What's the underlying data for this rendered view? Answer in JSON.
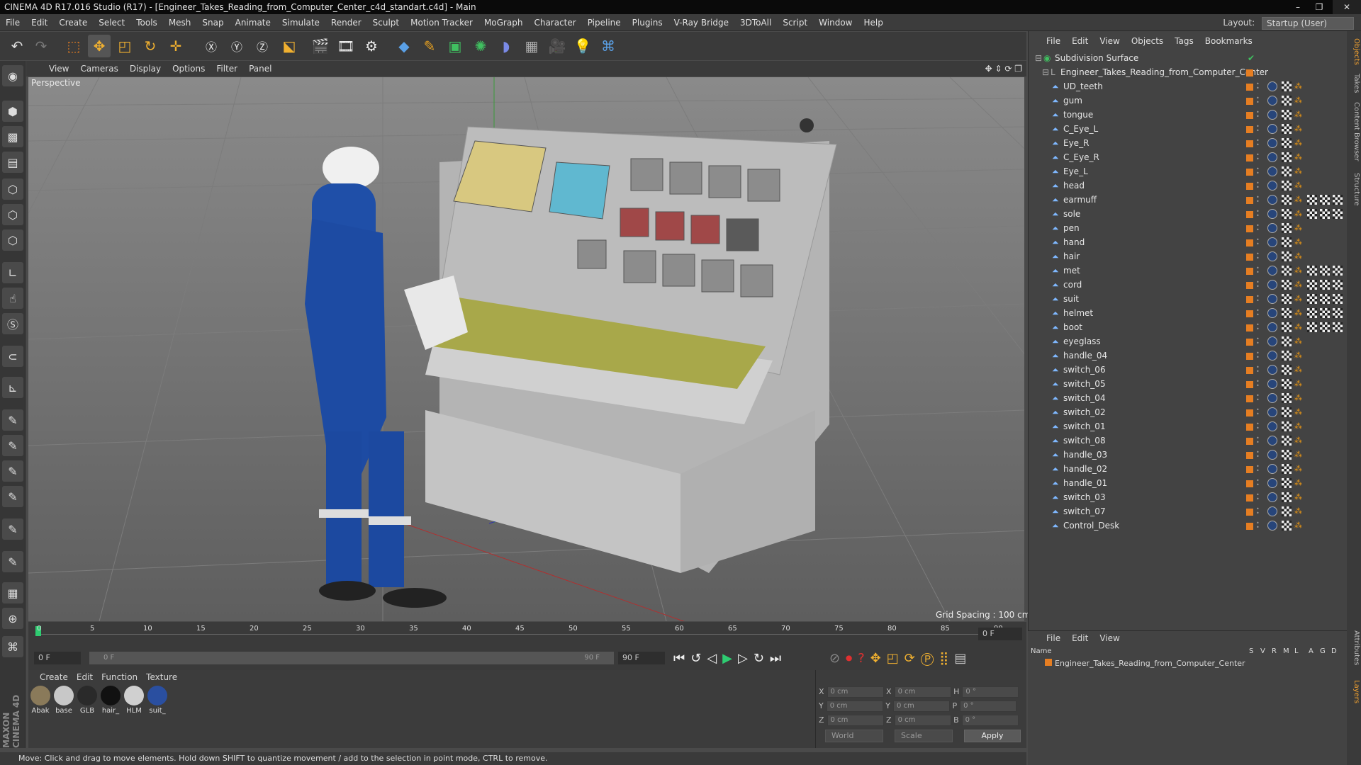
{
  "window": {
    "title": "CINEMA 4D R17.016 Studio (R17) - [Engineer_Takes_Reading_from_Computer_Center_c4d_standart.c4d] - Main"
  },
  "menubar": {
    "items": [
      "File",
      "Edit",
      "Create",
      "Select",
      "Tools",
      "Mesh",
      "Snap",
      "Animate",
      "Simulate",
      "Render",
      "Sculpt",
      "Motion Tracker",
      "MoGraph",
      "Character",
      "Pipeline",
      "Plugins",
      "V-Ray Bridge",
      "3DToAll",
      "Script",
      "Window",
      "Help"
    ],
    "layout_label": "Layout:",
    "layout_value": "Startup (User)"
  },
  "viewport": {
    "menu": [
      "View",
      "Cameras",
      "Display",
      "Options",
      "Filter",
      "Panel"
    ],
    "label": "Perspective",
    "grid_spacing": "Grid Spacing : 100 cm"
  },
  "timeline": {
    "ticks": [
      "0",
      "5",
      "10",
      "15",
      "20",
      "25",
      "30",
      "35",
      "40",
      "45",
      "50",
      "55",
      "60",
      "65",
      "70",
      "75",
      "80",
      "85",
      "90"
    ],
    "current_frame": "0 F",
    "start_frame": "0 F",
    "range_start": "0 F",
    "range_end": "90 F",
    "end_frame": "90 F"
  },
  "materials": {
    "menu": [
      "Create",
      "Edit",
      "Function",
      "Texture"
    ],
    "items": [
      {
        "label": "Abak",
        "color": "#8a7a5a"
      },
      {
        "label": "base",
        "color": "#c8c8c8"
      },
      {
        "label": "GLB",
        "color": "#2a2a2a"
      },
      {
        "label": "hair_",
        "color": "#111111"
      },
      {
        "label": "HLM",
        "color": "#d0d0d0"
      },
      {
        "label": "suit_",
        "color": "#2a4fa0"
      }
    ]
  },
  "coords": {
    "rows": [
      {
        "a": "X",
        "av": "0 cm",
        "b": "X",
        "bv": "0 cm",
        "c": "H",
        "cv": "0 °"
      },
      {
        "a": "Y",
        "av": "0 cm",
        "b": "Y",
        "bv": "0 cm",
        "c": "P",
        "cv": "0 °"
      },
      {
        "a": "Z",
        "av": "0 cm",
        "b": "Z",
        "bv": "0 cm",
        "c": "B",
        "cv": "0 °"
      }
    ],
    "world": "World",
    "scale": "Scale",
    "apply": "Apply"
  },
  "status": {
    "text": "Move: Click and drag to move elements. Hold down SHIFT to quantize movement / add to the selection in point mode, CTRL to remove."
  },
  "objects": {
    "menu": [
      "File",
      "Edit",
      "View",
      "Objects",
      "Tags",
      "Bookmarks"
    ],
    "root": "Subdivision Surface",
    "group": "Engineer_Takes_Reading_from_Computer_Center",
    "items": [
      "UD_teeth",
      "gum",
      "tongue",
      "C_Eye_L",
      "Eye_R",
      "C_Eye_R",
      "Eye_L",
      "head",
      "earmuff",
      "sole",
      "pen",
      "hand",
      "hair",
      "met",
      "cord",
      "suit",
      "helmet",
      "boot",
      "eyeglass",
      "handle_04",
      "switch_06",
      "switch_05",
      "switch_04",
      "switch_02",
      "switch_01",
      "switch_08",
      "handle_03",
      "handle_02",
      "handle_01",
      "switch_03",
      "switch_07",
      "Control_Desk"
    ]
  },
  "attributes": {
    "menu": [
      "File",
      "Edit",
      "View"
    ],
    "columns": [
      "Name",
      "S",
      "V",
      "R",
      "M",
      "L",
      "A",
      "G",
      "D"
    ],
    "layer_item": "Engineer_Takes_Reading_from_Computer_Center"
  },
  "side_tabs": [
    "Objects",
    "Takes",
    "Content Browser",
    "Structure",
    "Attributes",
    "Layers"
  ],
  "brand": "MAXON CINEMA 4D",
  "colors": {
    "accent": "#e67e22",
    "selection": "#2e5e9e",
    "bg": "#4a4a4a"
  }
}
